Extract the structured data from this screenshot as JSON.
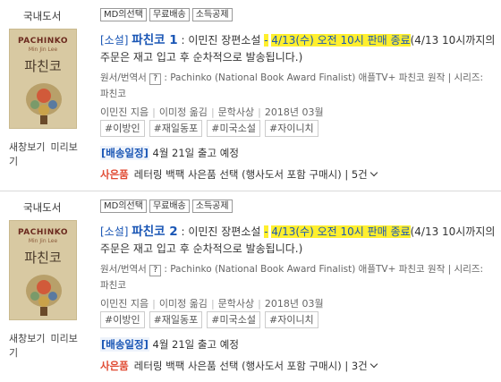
{
  "items": [
    {
      "category": "국내도서",
      "cover": {
        "title": "PACHINKO",
        "author": "Min Jin Lee",
        "korean": "파친코"
      },
      "left_links": [
        "새창보기",
        "미리보기"
      ],
      "tags": [
        "MD의선택",
        "무료배송",
        "소득공제"
      ],
      "title_prefix": "[소설]",
      "title_name": "파친코 1",
      "title_sub": "이민진 장편소설",
      "title_dash": "-",
      "title_highlight": "4/13(수) 오전 10시 판매 종료",
      "title_note": "(4/13 10시까지의 주문은 재고 입고 후 순차적으로 발송됩니다.)",
      "meta_label": "원서/번역서",
      "meta_q": "?",
      "meta_rest": ": Pachinko (National Book Award Finalist) 애플TV+ 파친코 원작 | 시리즈: 파친코",
      "author": "이민진 지음",
      "translator": "이미정 옮김",
      "publisher": "문학사상",
      "date": "2018년 03월",
      "hashtags": [
        "#이방인",
        "#재일동포",
        "#미국소설",
        "#자이니치"
      ],
      "delivery_label": "[배송일정]",
      "delivery_text": "4월 21일 출고 예정",
      "gift_label": "사은품",
      "gift_text": "레터링 백팩 사은품 선택 (행사도서 포함 구매시) | 5건"
    },
    {
      "category": "국내도서",
      "cover": {
        "title": "PACHINKO",
        "author": "Min Jin Lee",
        "korean": "파친코"
      },
      "left_links": [
        "새창보기",
        "미리보기"
      ],
      "tags": [
        "MD의선택",
        "무료배송",
        "소득공제"
      ],
      "title_prefix": "[소설]",
      "title_name": "파친코 2",
      "title_sub": "이민진 장편소설",
      "title_dash": "-",
      "title_highlight": "4/13(수) 오전 10시 판매 종료",
      "title_note": "(4/13 10시까지의 주문은 재고 입고 후 순차적으로 발송됩니다.)",
      "meta_label": "원서/번역서",
      "meta_q": "?",
      "meta_rest": ": Pachinko (National Book Award Finalist) 애플TV+ 파친코 원작 | 시리즈: 파친코",
      "author": "이민진 지음",
      "translator": "이미정 옮김",
      "publisher": "문학사상",
      "date": "2018년 03월",
      "hashtags": [
        "#이방인",
        "#재일동포",
        "#미국소설",
        "#자이니치"
      ],
      "delivery_label": "[배송일정]",
      "delivery_text": "4월 21일 출고 예정",
      "gift_label": "사은품",
      "gift_text": "레터링 백팩 사은품 선택 (행사도서 포함 구매시) | 3건"
    }
  ],
  "colors": {
    "link_blue": "#1a56b5",
    "highlight": "#ffef2e",
    "gift_red": "#e04a32"
  }
}
